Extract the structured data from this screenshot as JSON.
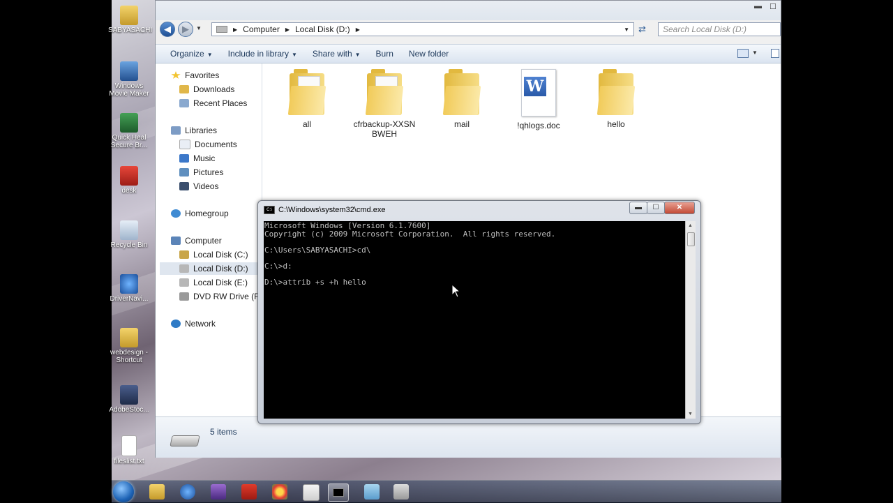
{
  "desktop": {
    "icons": [
      {
        "label": "SABYASACHI"
      },
      {
        "label": "Windows Movie Maker"
      },
      {
        "label": "Quick Heal Secure Br..."
      },
      {
        "label": "desk"
      },
      {
        "label": "Recycle Bin"
      },
      {
        "label": "DriverNavi..."
      },
      {
        "label": "webdesign - Shortcut"
      },
      {
        "label": "AdobeStoc..."
      },
      {
        "label": "fileslist.txt"
      }
    ]
  },
  "explorer": {
    "breadcrumb": [
      "Computer",
      "Local Disk (D:)"
    ],
    "search_placeholder": "Search Local Disk (D:)",
    "toolbar": {
      "organize": "Organize",
      "include": "Include in library",
      "share": "Share with",
      "burn": "Burn",
      "new_folder": "New folder"
    },
    "nav": {
      "favorites": "Favorites",
      "downloads": "Downloads",
      "recent": "Recent Places",
      "libraries": "Libraries",
      "documents": "Documents",
      "music": "Music",
      "pictures": "Pictures",
      "videos": "Videos",
      "homegroup": "Homegroup",
      "computer": "Computer",
      "disk_c": "Local Disk (C:)",
      "disk_d": "Local Disk (D:)",
      "disk_e": "Local Disk (E:)",
      "dvd": "DVD RW Drive (F:) (",
      "network": "Network"
    },
    "files": [
      {
        "name": "all",
        "type": "folder"
      },
      {
        "name": "cfrbackup-XXSNBWEH",
        "type": "folder"
      },
      {
        "name": "mail",
        "type": "folder"
      },
      {
        "name": "!qhlogs.doc",
        "type": "doc"
      },
      {
        "name": "hello",
        "type": "folder"
      }
    ],
    "status": "5 items"
  },
  "cmd": {
    "title": "C:\\Windows\\system32\\cmd.exe",
    "console_text": "Microsoft Windows [Version 6.1.7600]\nCopyright (c) 2009 Microsoft Corporation.  All rights reserved.\n\nC:\\Users\\SABYASACHI>cd\\\n\nC:\\>d:\n\nD:\\>attrib +s +h hello"
  }
}
